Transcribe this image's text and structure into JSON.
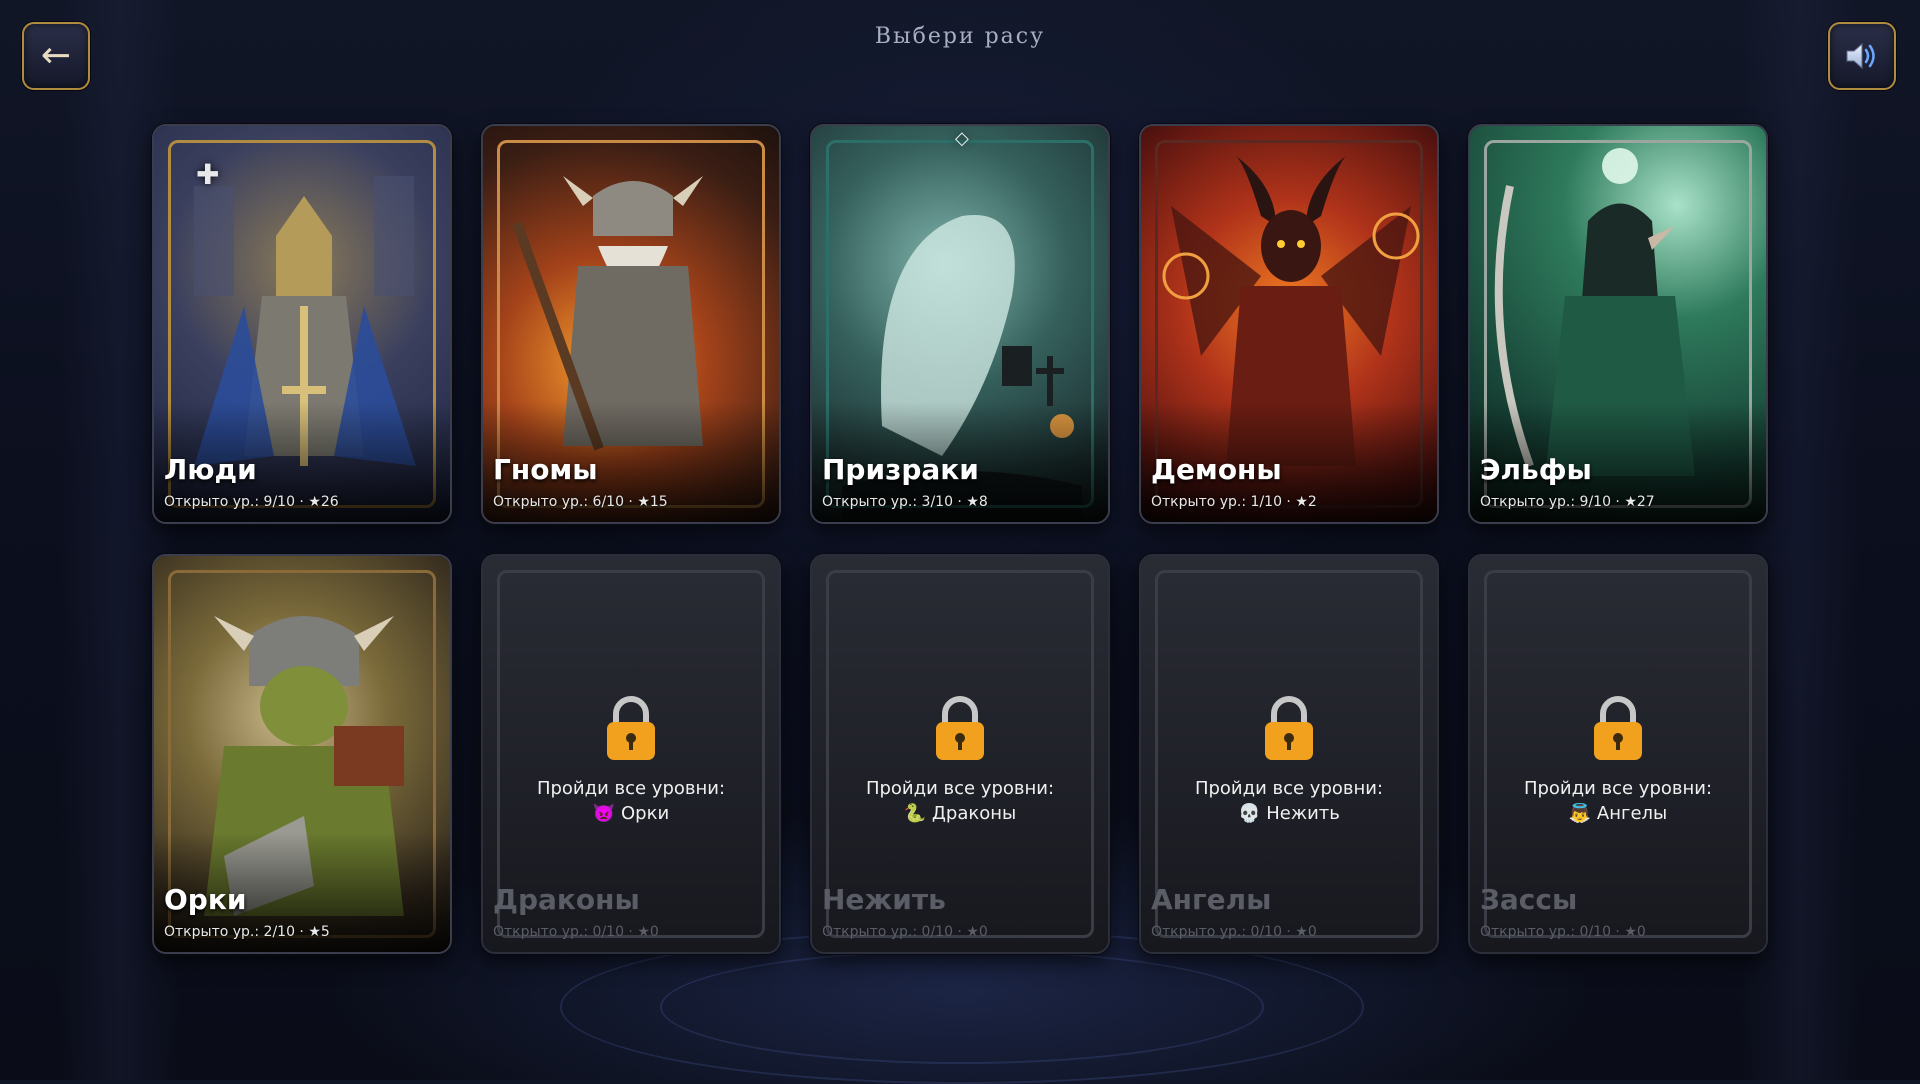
{
  "header": {
    "title": "Выбери расу",
    "back_label": "←"
  },
  "colors": {
    "frame_gold": "#b18b3f",
    "lock_orange": "#f2a11f",
    "humans": "#2e4a8c",
    "dwarves": "#b5461a",
    "ghosts": "#2f6d66",
    "demons": "#a32912",
    "elves": "#1f5a45",
    "orcs": "#6e6a2a"
  },
  "cards": [
    {
      "name": "Люди",
      "stats": "Открыто ур.: 9/10 · ★26",
      "locked": false
    },
    {
      "name": "Гномы",
      "stats": "Открыто ур.: 6/10 · ★15",
      "locked": false
    },
    {
      "name": "Призраки",
      "stats": "Открыто ур.: 3/10 · ★8",
      "locked": false
    },
    {
      "name": "Демоны",
      "stats": "Открыто ур.: 1/10 · ★2",
      "locked": false
    },
    {
      "name": "Эльфы",
      "stats": "Открыто ур.: 9/10 · ★27",
      "locked": false
    },
    {
      "name": "Орки",
      "stats": "Открыто ур.: 2/10 · ★5",
      "locked": false
    },
    {
      "name": "Драконы",
      "stats": "Открыто ур.: 0/10 · ★0",
      "locked": true,
      "req_label": "Пройди все уровни:",
      "req_race": "👿 Орки"
    },
    {
      "name": "Нежить",
      "stats": "Открыто ур.: 0/10 · ★0",
      "locked": true,
      "req_label": "Пройди все уровни:",
      "req_race": "🐍 Драконы"
    },
    {
      "name": "Ангелы",
      "stats": "Открыто ур.: 0/10 · ★0",
      "locked": true,
      "req_label": "Пройди все уровни:",
      "req_race": "💀 Нежить"
    },
    {
      "name": "Зассы",
      "stats": "Открыто ур.: 0/10 · ★0",
      "locked": true,
      "req_label": "Пройди все уровни:",
      "req_race": "👼 Ангелы"
    }
  ],
  "icons": {
    "back": "back-arrow-icon",
    "sound": "speaker-icon",
    "lock": "padlock-icon"
  }
}
